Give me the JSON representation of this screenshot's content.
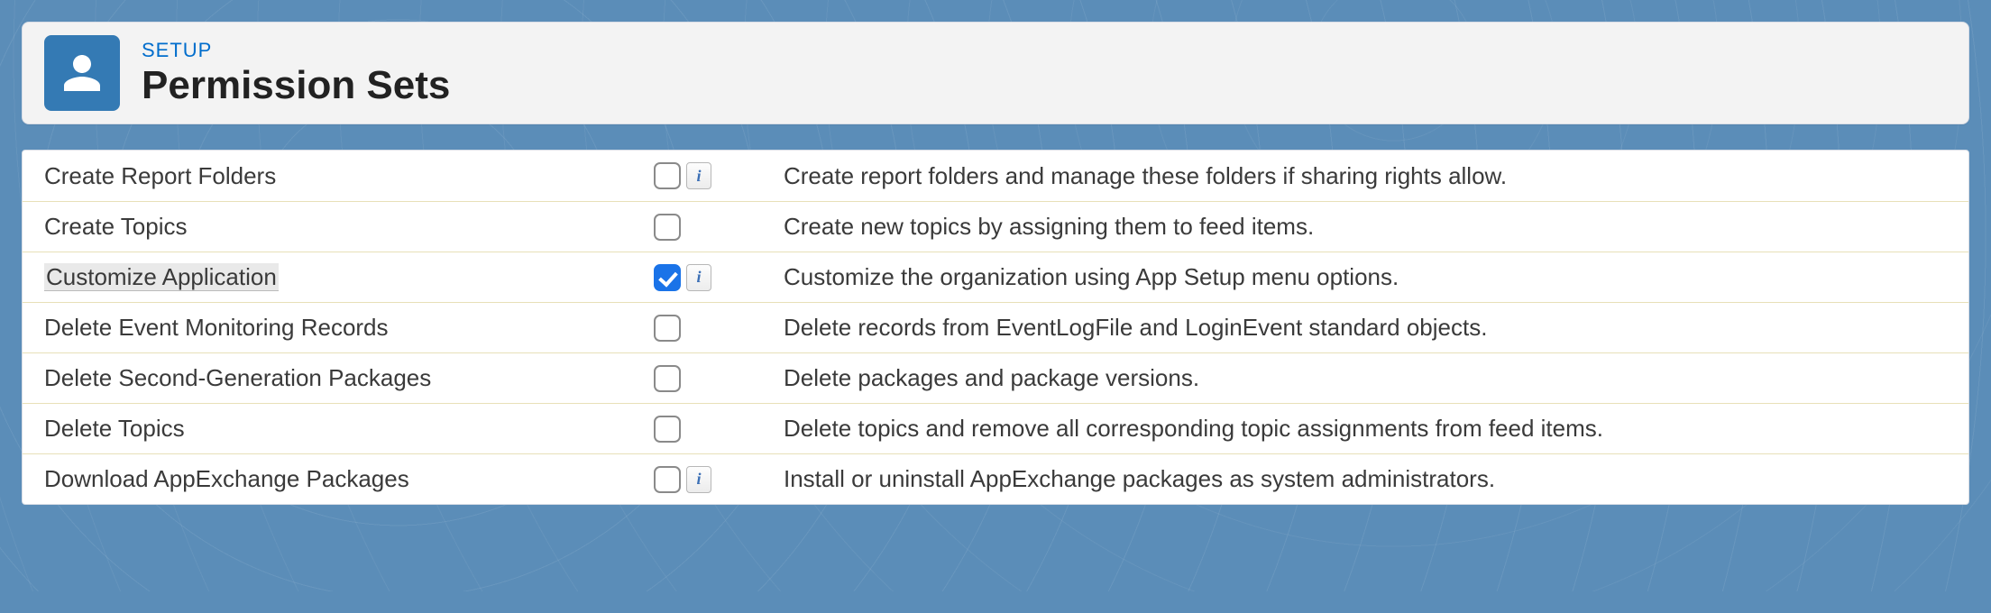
{
  "header": {
    "eyebrow": "SETUP",
    "title": "Permission Sets"
  },
  "permissions": [
    {
      "label": "Create Report Folders",
      "checked": false,
      "has_info": true,
      "highlighted": false,
      "description": "Create report folders and manage these folders if sharing rights allow."
    },
    {
      "label": "Create Topics",
      "checked": false,
      "has_info": false,
      "highlighted": false,
      "description": "Create new topics by assigning them to feed items."
    },
    {
      "label": "Customize Application",
      "checked": true,
      "has_info": true,
      "highlighted": true,
      "description": "Customize the organization using App Setup menu options."
    },
    {
      "label": "Delete Event Monitoring Records",
      "checked": false,
      "has_info": false,
      "highlighted": false,
      "description": "Delete records from EventLogFile and LoginEvent standard objects."
    },
    {
      "label": "Delete Second-Generation Packages",
      "checked": false,
      "has_info": false,
      "highlighted": false,
      "description": "Delete packages and package versions."
    },
    {
      "label": "Delete Topics",
      "checked": false,
      "has_info": false,
      "highlighted": false,
      "description": "Delete topics and remove all corresponding topic assignments from feed items."
    },
    {
      "label": "Download AppExchange Packages",
      "checked": false,
      "has_info": true,
      "highlighted": false,
      "description": "Install or uninstall AppExchange packages as system administrators."
    }
  ],
  "info_glyph": "i"
}
